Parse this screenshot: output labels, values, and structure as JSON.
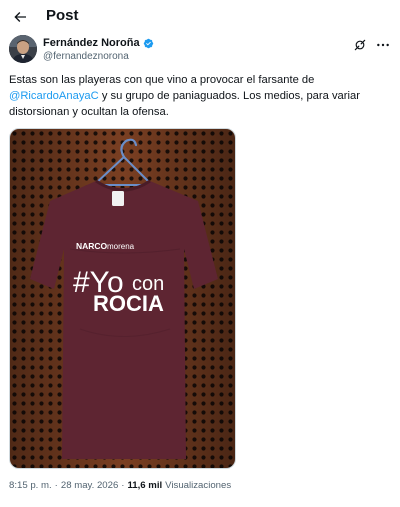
{
  "header": {
    "title": "Post",
    "back_icon": "arrow-left-icon"
  },
  "author": {
    "display_name": "Fernández Noroña",
    "handle": "@fernandeznorona",
    "verified": true,
    "verified_color": "#1d9bf0"
  },
  "actions": {
    "grok_icon": "grok-icon",
    "more_icon": "more-dots-icon"
  },
  "tweet": {
    "text_before": "Estas son las playeras con que vino a provocar el farsante de ",
    "mention": "@RicardoAnayaC",
    "text_after": " y su grupo de paniaguados. Los medios, para variar distorsionan y ocultan la ofensa.",
    "mention_color": "#1d9bf0"
  },
  "media": {
    "shirt": {
      "color": "#5e2532",
      "brand_bold": "NARCO",
      "brand_light": "morena",
      "line1_hash": "#Yo",
      "line1_word": "con",
      "line2": "ROCIA"
    }
  },
  "meta": {
    "time": "8:15 p. m.",
    "separator": "·",
    "date": "28 may. 2026",
    "views_count": "11,6 mil",
    "views_label": "Visualizaciones"
  }
}
